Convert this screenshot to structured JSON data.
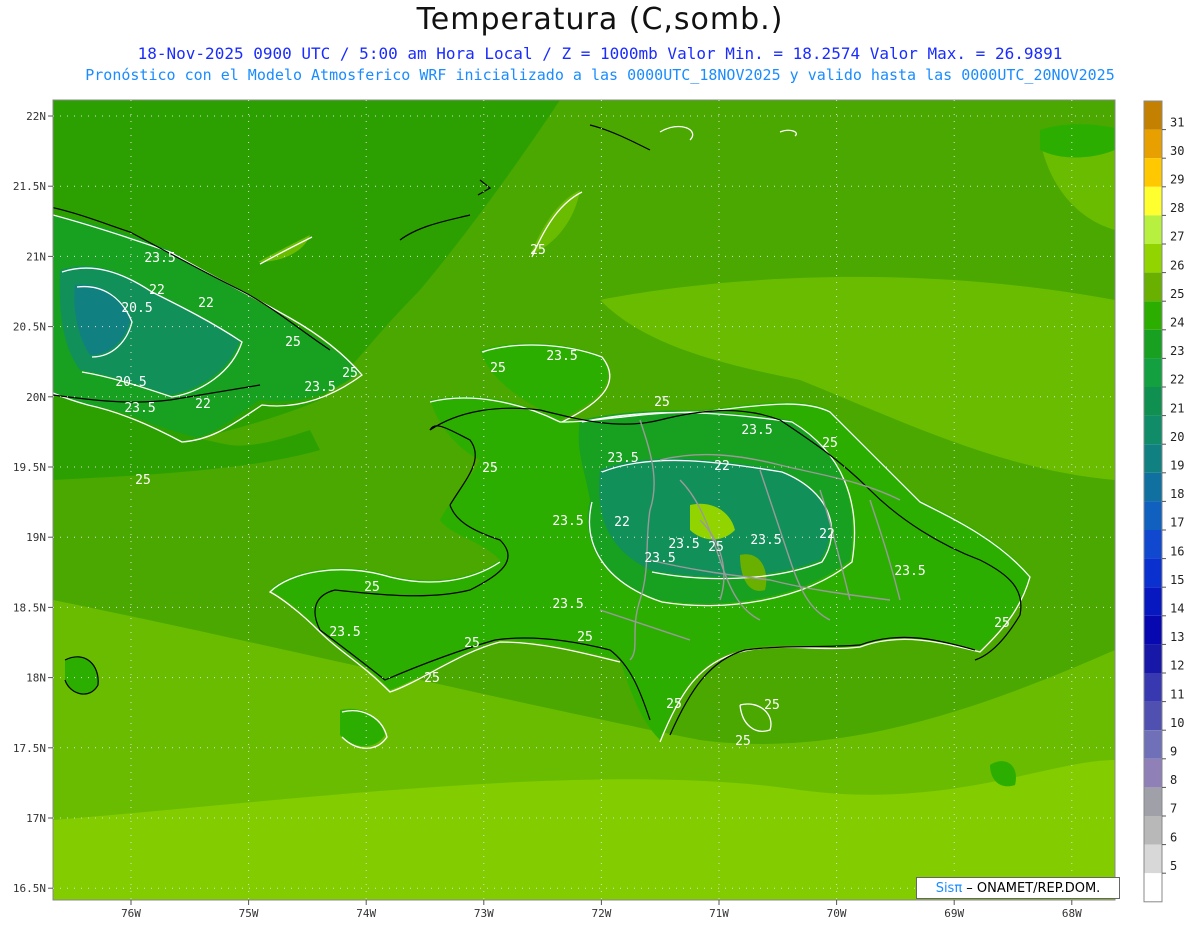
{
  "header": {
    "title": "Temperatura (C,somb.)",
    "line1": "18-Nov-2025  0900 UTC / 5:00 am Hora Local / Z = 1000mb    Valor Min. = 18.2574  Valor Max. = 26.9891",
    "line2": "Pronóstico con el Modelo Atmosferico WRF inicializado a las 0000UTC_18NOV2025 y valido hasta las  0000UTC_20NOV2025"
  },
  "axes": {
    "lat_labels": [
      "22N",
      "21.5N",
      "21N",
      "20.5N",
      "20N",
      "19.5N",
      "19N",
      "18.5N",
      "18N",
      "17.5N",
      "17N",
      "16.5N"
    ],
    "lon_labels": [
      "76W",
      "75W",
      "74W",
      "73W",
      "72W",
      "71W",
      "70W",
      "69W",
      "68W"
    ]
  },
  "legend": {
    "labels": [
      "31",
      "30",
      "29",
      "28",
      "27",
      "26",
      "25",
      "24",
      "23",
      "22",
      "21",
      "20",
      "19",
      "18",
      "17",
      "16",
      "15",
      "14",
      "13",
      "12",
      "11",
      "10",
      "9",
      "8",
      "7",
      "6",
      "5"
    ],
    "colors": [
      "#c48000",
      "#e8a000",
      "#ffc800",
      "#ffff30",
      "#b8f040",
      "#92d400",
      "#6ab000",
      "#2cae00",
      "#18a020",
      "#12a040",
      "#109050",
      "#108c68",
      "#108080",
      "#1070a0",
      "#1060c0",
      "#1048d0",
      "#0a30d0",
      "#0818c0",
      "#0808b0",
      "#1818a8",
      "#3838b0",
      "#5050b0",
      "#7070b8",
      "#9080b8",
      "#a0a0a8",
      "#b8b8b8",
      "#d8d8d8",
      "#ffffff"
    ]
  },
  "contour_labels": [
    {
      "text": "23.5"
    },
    {
      "text": "22"
    },
    {
      "text": "20.5"
    },
    {
      "text": "22"
    },
    {
      "text": "20.5"
    },
    {
      "text": "22"
    },
    {
      "text": "23.5"
    },
    {
      "text": "25"
    },
    {
      "text": "23.5"
    },
    {
      "text": "25"
    },
    {
      "text": "25"
    },
    {
      "text": "25"
    },
    {
      "text": "23.5"
    },
    {
      "text": "25"
    },
    {
      "text": "25"
    },
    {
      "text": "23.5"
    },
    {
      "text": "22"
    },
    {
      "text": "23.5"
    },
    {
      "text": "22"
    },
    {
      "text": "23.5"
    },
    {
      "text": "25"
    },
    {
      "text": "23.5"
    },
    {
      "text": "22"
    },
    {
      "text": "23.5"
    },
    {
      "text": "23.5"
    },
    {
      "text": "25"
    },
    {
      "text": "23.5"
    },
    {
      "text": "23.5"
    },
    {
      "text": "25"
    },
    {
      "text": "23.5"
    },
    {
      "text": "25"
    },
    {
      "text": "25"
    },
    {
      "text": "25"
    },
    {
      "text": "25"
    },
    {
      "text": "25"
    },
    {
      "text": "25"
    },
    {
      "text": "25"
    },
    {
      "text": "25"
    }
  ],
  "credit": {
    "sis": "Sisπ",
    "rest": " – ONAMET/REP.DOM."
  }
}
